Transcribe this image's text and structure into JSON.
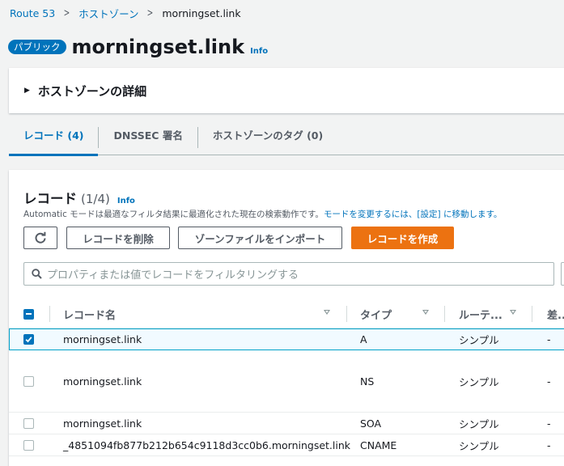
{
  "breadcrumb": {
    "items": [
      "Route 53",
      "ホストゾーン",
      "morningset.link"
    ],
    "separator": ">"
  },
  "header": {
    "badge": "パブリック",
    "title": "morningset.link",
    "info": "Info"
  },
  "details": {
    "caret": "▶",
    "title": "ホストゾーンの詳細"
  },
  "tabs": [
    {
      "label": "レコード (4)",
      "active": true
    },
    {
      "label": "DNSSEC 署名",
      "active": false
    },
    {
      "label": "ホストゾーンのタグ (0)",
      "active": false
    }
  ],
  "records": {
    "title": "レコード",
    "count": "(1/4)",
    "info": "Info",
    "desc_prefix": "Automatic モードは最適なフィルタ結果に最適化された現在の検索動作です。",
    "desc_link": "モードを変更するには、[設定] に移動します。",
    "buttons": {
      "refresh_icon": "refresh-icon",
      "delete": "レコードを削除",
      "import": "ゾーンファイルをインポート",
      "create": "レコードを作成"
    },
    "search_placeholder": "プロパティまたは値でレコードをフィルタリングする",
    "columns": [
      "レコード名",
      "タイプ",
      "ルーテ...",
      "差..."
    ],
    "rows": [
      {
        "name": "morningset.link",
        "type": "A",
        "routing": "シンプル",
        "diff": "-",
        "checked": true
      },
      {
        "name": "morningset.link",
        "type": "NS",
        "routing": "シンプル",
        "diff": "-",
        "checked": false
      },
      {
        "name": "morningset.link",
        "type": "SOA",
        "routing": "シンプル",
        "diff": "-",
        "checked": false
      },
      {
        "name": "_4851094fb877b212b654c9118d3cc0b6.morningset.link",
        "type": "CNAME",
        "routing": "シンプル",
        "diff": "-",
        "checked": false
      }
    ]
  },
  "colors": {
    "link": "#0073bb",
    "primary_button": "#ec7211",
    "selected_row_bg": "#f1faff",
    "selected_row_border": "#00a1c9"
  }
}
